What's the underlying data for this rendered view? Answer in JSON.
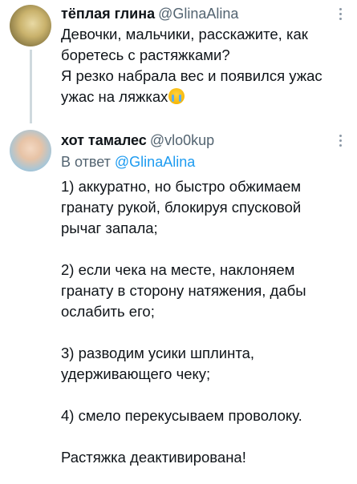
{
  "tweets": [
    {
      "name": "тёплая глина",
      "handle": "@GlinaAlina",
      "lines": [
        "Девочки, мальчики, расскажите, как",
        "боретесь с растяжками?",
        "Я резко набрала вес и появился ужас",
        "ужас на ляжках"
      ],
      "emoji": "loudly-crying-face"
    },
    {
      "name": "хот тамалес",
      "handle": "@vlo0kup",
      "reply_label": "В ответ",
      "reply_mention": "@GlinaAlina",
      "paragraphs": [
        "1) аккуратно, но быстро обжимаем гранату рукой, блокируя спусковой рычаг запала;",
        "2) если чека на месте, наклоняем гранату в сторону натяжения, дабы ослабить его;",
        "3) разводим усики шплинта, удерживающего чеку;",
        "4) смело перекусываем проволоку.",
        "Растяжка деактивирована!"
      ]
    }
  ],
  "colors": {
    "text": "#0f1419",
    "secondary": "#536471",
    "link": "#1d9bf0",
    "thread_line": "#cfd9de"
  }
}
